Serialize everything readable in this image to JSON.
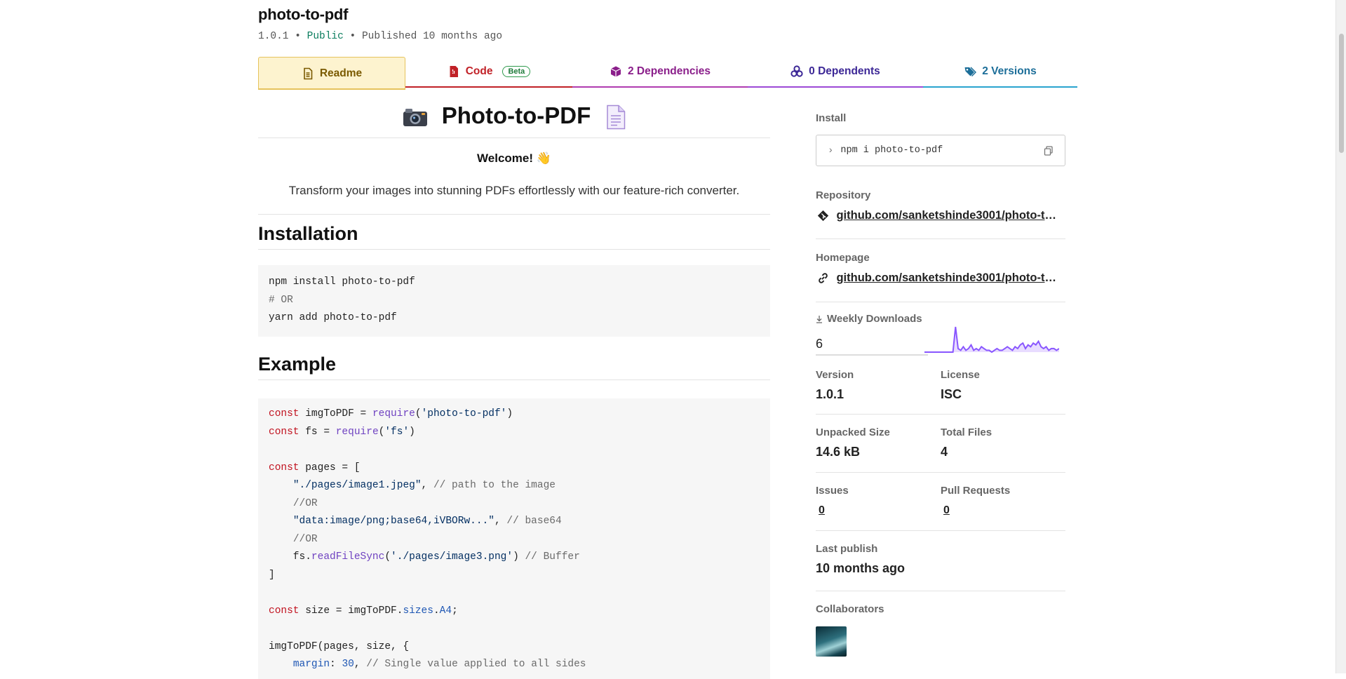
{
  "package": {
    "name": "photo-to-pdf",
    "version": "1.0.1",
    "visibility": "Public",
    "published": "Published 10 months ago"
  },
  "tabs": {
    "readme": "Readme",
    "code": "Code",
    "beta": "Beta",
    "dependencies": "2 Dependencies",
    "dependents": "0 Dependents",
    "versions": "2 Versions"
  },
  "readme": {
    "title": "Photo-to-PDF",
    "welcome": "Welcome! 👋",
    "tagline": "Transform your images into stunning PDFs effortlessly with our feature-rich converter.",
    "installation_heading": "Installation",
    "install_code": [
      "npm install photo-to-pdf",
      "# OR",
      "yarn add photo-to-pdf"
    ],
    "example_heading": "Example"
  },
  "sidebar": {
    "install_label": "Install",
    "install_cmd": "npm i photo-to-pdf",
    "repository_label": "Repository",
    "repository_url": "github.com/sanketshinde3001/photo-to-pdf",
    "homepage_label": "Homepage",
    "homepage_url": "github.com/sanketshinde3001/photo-to-pdf",
    "weekly_label": "Weekly Downloads",
    "weekly_value": "6",
    "version_label": "Version",
    "version_value": "1.0.1",
    "license_label": "License",
    "license_value": "ISC",
    "unpacked_label": "Unpacked Size",
    "unpacked_value": "14.6 kB",
    "files_label": "Total Files",
    "files_value": "4",
    "issues_label": "Issues",
    "issues_value": "0",
    "pr_label": "Pull Requests",
    "pr_value": "0",
    "last_publish_label": "Last publish",
    "last_publish_value": "10 months ago",
    "collaborators_label": "Collaborators"
  },
  "sparkline": [
    0,
    0,
    0,
    0,
    0,
    0,
    0,
    0,
    0,
    0,
    0,
    0,
    14,
    2,
    1,
    3,
    1,
    2,
    4,
    1,
    2,
    1,
    3,
    2,
    1,
    1,
    0,
    1,
    2,
    1,
    1,
    2,
    3,
    2,
    1,
    3,
    2,
    4,
    5,
    2,
    4,
    3,
    5,
    4,
    6,
    3,
    2,
    3,
    1,
    2,
    2,
    1,
    2
  ],
  "colors": {
    "accent_purple": "#8956ff",
    "public_green": "#0b7d5e"
  }
}
